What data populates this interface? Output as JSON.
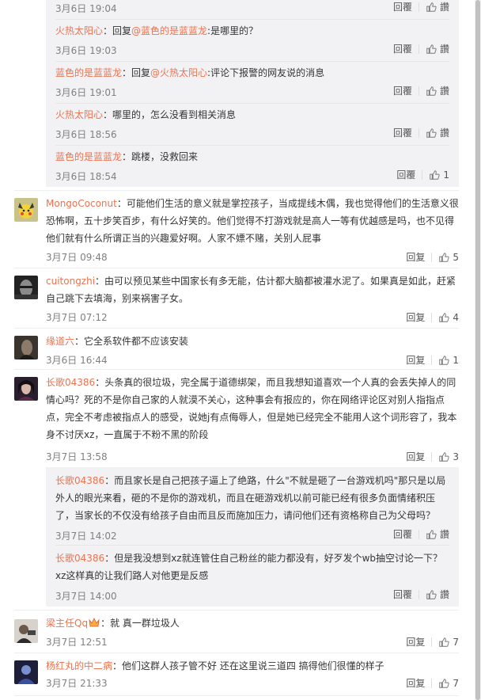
{
  "nested_top": [
    {
      "time": "3月6日 19:04",
      "reply": "回覆",
      "like_label": "讚"
    },
    {
      "name": "火热太阳心",
      "prefix": "：回复",
      "mention": "@蓝色的是蓝蓝龙",
      "rest": ":是哪里的？",
      "time": "3月6日 19:03",
      "reply": "回覆",
      "like_label": "讚"
    },
    {
      "name": "蓝色的是蓝蓝龙",
      "prefix": "：回复",
      "mention": "@火热太阳心",
      "rest": ":评论下报警的网友说的消息",
      "time": "3月6日 19:01",
      "reply": "回覆",
      "like_label": "讚"
    },
    {
      "name": "火热太阳心",
      "text": "：哪里的，怎么没看到相关消息",
      "time": "3月6日 18:56",
      "reply": "回覆",
      "like_label": "讚"
    },
    {
      "name": "蓝色的是蓝蓝龙",
      "text": "：跳楼，没救回来",
      "time": "3月6日 18:54",
      "reply": "回覆",
      "like_count": "1"
    }
  ],
  "comments": [
    {
      "name": "MongoCoconut",
      "text": "：可能他们生活的意义就是掌控孩子，当成提线木偶，我也觉得他们的生活意义很恐怖啊，五十步笑百步，有什么好笑的。他们觉得不打游戏就是高人一等有优越感是吗，也不见得他们就有什么所谓正当的兴趣爱好啊。人家不嫖不赌，关别人屁事",
      "time": "3月7日 09:48",
      "reply": "回复",
      "likes": "5"
    },
    {
      "name": "cuitongzhi",
      "text": "：由可以预见某些中国家长有多无能，估计都大脑都被灌水泥了。如果真是如此，赶紧自己跳下去填海，别来祸害子女。",
      "time": "3月7日 07:12",
      "reply": "回复",
      "likes": "4"
    },
    {
      "name": "缘道六",
      "text": "：它全系软件都不应该安装",
      "time": "3月6日 16:44",
      "reply": "回复",
      "likes": "1"
    },
    {
      "name": "长歌04386",
      "text": "：头条真的很垃圾，完全属于道德绑架，而且我想知道喜欢一个人真的会丢失掉人的同情心吗？死的不是你自己家的人就漠不关心，这种事会有报应的，你在网络评论区对别人指指点点，完全不考虑被指点人的感受，说她j有点侮辱人，但是她已经完全不能用人这个词形容了，我本身不讨厌xz，一直属于不粉不黑的阶段",
      "time": "3月7日 13:58",
      "reply": "回复",
      "likes": "3"
    },
    {
      "name": "梁主任Qq",
      "text": "：就 真一群垃圾人",
      "time": "3月7日 12:51",
      "reply": "回复",
      "likes": "7"
    },
    {
      "name": "杨红丸的中二病",
      "text": "：他们这群人孩子管不好 还在这里说三道四 搞得他们很懂的样子",
      "time": "3月7日 21:33",
      "reply": "回复",
      "likes": "7"
    }
  ],
  "nested_bottom": [
    {
      "name": "长歌04386",
      "text": "：而且家长是自己把孩子逼上了绝路，什么\"不就是砸了一台游戏机吗\"那只是以局外人的眼光来看，砸的不是你的游戏机，而且在砸游戏机以前可能已经有很多负面情绪积压了，当家长的不仅没有给孩子自由而且反而施加压力，请问他们还有资格称自己为父母吗？",
      "time": "3月7日 14:02",
      "reply": "回覆",
      "like_label": "讚"
    },
    {
      "name": "长歌04386",
      "text": "：但是我没想到xz就连管住自己粉丝的能力都没有，好歹发个wb抽空讨论一下？xz这样真的让我们路人对他更是反感",
      "time": "3月7日 14:00",
      "reply": "回覆",
      "like_label": "讚"
    }
  ]
}
